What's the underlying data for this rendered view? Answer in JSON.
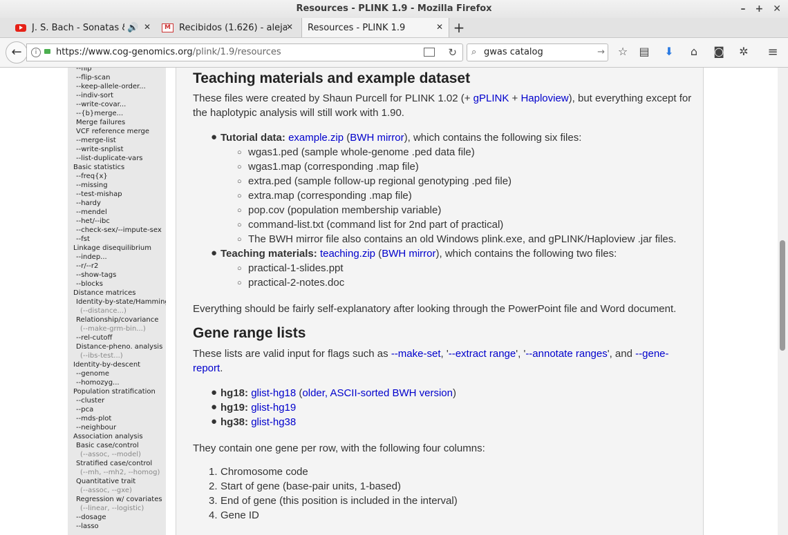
{
  "window": {
    "title": "Resources - PLINK 1.9 - Mozilla Firefox",
    "controls": [
      "–",
      "+",
      "✕"
    ]
  },
  "tabs": [
    {
      "label": "J. S. Bach - Sonatas & Pa",
      "icon": "youtube-icon"
    },
    {
      "label": "Recibidos (1.626) - alejandr",
      "icon": "gmail-icon"
    },
    {
      "label": "Resources - PLINK 1.9",
      "icon": ""
    }
  ],
  "navbar": {
    "url_host": "https://www.cog-genomics.org",
    "url_path": "/plink/1.9/resources",
    "search_value": "gwas catalog"
  },
  "sidebar": {
    "items": [
      "--flip",
      "--flip-scan",
      "--keep-allele-order...",
      "--indiv-sort",
      "--write-covar...",
      "--{b}merge...",
      "Merge failures",
      "VCF reference merge",
      "--merge-list",
      "--write-snplist",
      "--list-duplicate-vars",
      "Basic statistics",
      "--freq{x}",
      "--missing",
      "--test-mishap",
      "--hardy",
      "--mendel",
      "--het/--ibc",
      "--check-sex/--impute-sex",
      "--fst",
      "Linkage disequilibrium",
      "--indep...",
      "--r/--r2",
      "--show-tags",
      "--blocks",
      "Distance matrices",
      "Identity-by-state/Hamming",
      "(--distance...)",
      "Relationship/covariance",
      "(--make-grm-bin...)",
      "--rel-cutoff",
      "Distance-pheno. analysis",
      "(--ibs-test...)",
      "Identity-by-descent",
      "--genome",
      "--homozyg...",
      "Population stratification",
      "--cluster",
      "--pca",
      "--mds-plot",
      "--neighbour",
      "Association analysis",
      "Basic case/control",
      "(--assoc, --model)",
      "Stratified case/control",
      "(--mh, --mh2, --homog)",
      "Quantitative trait",
      "(--assoc, --gxe)",
      "Regression w/ covariates",
      "(--linear, --logistic)",
      "--dosage",
      "--lasso"
    ]
  },
  "content": {
    "h_teaching": "Teaching materials and example dataset",
    "intro_1": "These files were created by Shaun Purcell for PLINK 1.02 (+ ",
    "intro_gplink": "gPLINK",
    "intro_plus": " + ",
    "intro_haploview": "Haploview",
    "intro_2": "), but everything except for",
    "intro_3": "the haplotypic analysis will still work with 1.90.",
    "tut_label": "Tutorial data:",
    "tut_link": "example.zip",
    "tut_paren_open": " (",
    "tut_mirror": "BWH mirror",
    "tut_rest": "), which contains the following six files:",
    "tut_files": [
      "wgas1.ped (sample whole-genome .ped data file)",
      "wgas1.map (corresponding .map file)",
      "extra.ped (sample follow-up regional genotyping .ped file)",
      "extra.map (corresponding .map file)",
      "pop.cov (population membership variable)",
      "command-list.txt (command list for 2nd part of practical)",
      "The BWH mirror file also contains an old Windows plink.exe, and gPLINK/Haploview .jar files."
    ],
    "teach_label": "Teaching materials:",
    "teach_link": "teaching.zip",
    "teach_paren_open": " (",
    "teach_mirror": "BWH mirror",
    "teach_rest": "), which contains the following two files:",
    "teach_files": [
      "practical-1-slides.ppt",
      "practical-2-notes.doc"
    ],
    "explain": "Everything should be fairly self-explanatory after looking through the PowerPoint file and Word document.",
    "h_gene": "Gene range lists",
    "gene_1": "These lists are valid input for flags such as ",
    "gene_makeset": "--make-set",
    "gene_c1": ", '",
    "gene_extract": "--extract range",
    "gene_c2": "', '",
    "gene_annotate": "--annotate ranges",
    "gene_c3": "', and ",
    "gene_gene": "--gene-",
    "gene_report": "report",
    "gene_dot": ".",
    "hg18_label": "hg18:",
    "hg18_link": "glist-hg18",
    "hg18_paren_open": " (",
    "hg18_older": "older, ASCII-sorted BWH version",
    "hg18_paren_close": ")",
    "hg19_label": "hg19:",
    "hg19_link": "glist-hg19",
    "hg38_label": "hg38:",
    "hg38_link": "glist-hg38",
    "columns_intro": "They contain one gene per row, with the following four columns:",
    "columns": [
      "Chromosome code",
      "Start of gene (base-pair units, 1-based)",
      "End of gene (this position is included in the interval)",
      "Gene ID"
    ]
  }
}
